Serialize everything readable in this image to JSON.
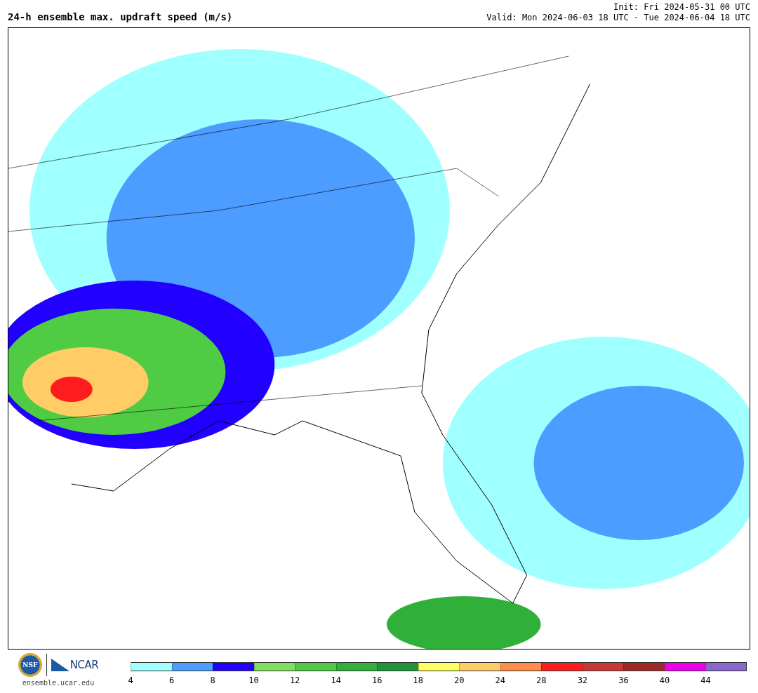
{
  "header": {
    "title": "24-h ensemble max. updraft speed (m/s)",
    "init": "Init: Fri 2024-05-31 00 UTC",
    "valid": "Valid: Mon 2024-06-03 18 UTC - Tue 2024-06-04 18 UTC"
  },
  "logos": [
    {
      "kind": "nsf",
      "text": "NSF"
    },
    {
      "kind": "ncar",
      "text": "NCAR"
    }
  ],
  "site": "ensemble.ucar.edu",
  "legend": {
    "bins": [
      {
        "label": "4",
        "color": "#a0ffff"
      },
      {
        "label": "6",
        "color": "#4d9cff"
      },
      {
        "label": "8",
        "color": "#2200ff"
      },
      {
        "label": "10",
        "color": "#80e060"
      },
      {
        "label": "12",
        "color": "#50cc44"
      },
      {
        "label": "14",
        "color": "#30b038"
      },
      {
        "label": "16",
        "color": "#1e9638"
      },
      {
        "label": "18",
        "color": "#ffff60"
      },
      {
        "label": "20",
        "color": "#ffcc66"
      },
      {
        "label": "24",
        "color": "#ff8c48"
      },
      {
        "label": "28",
        "color": "#ff1c1c"
      },
      {
        "label": "32",
        "color": "#c83838"
      },
      {
        "label": "36",
        "color": "#a02828"
      },
      {
        "label": "40",
        "color": "#ee00ee"
      },
      {
        "label": "44",
        "color": "#8866cc"
      }
    ]
  }
}
